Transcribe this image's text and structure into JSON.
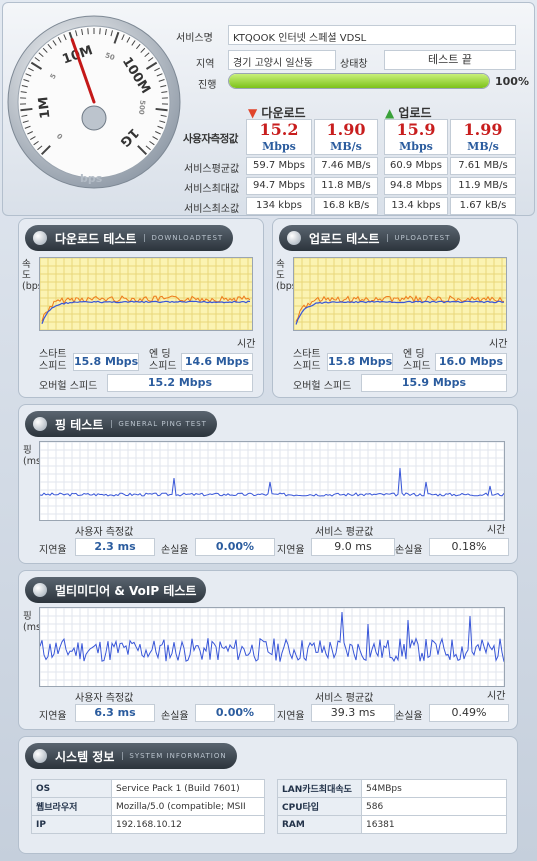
{
  "gauge": {
    "ticks": [
      "0",
      "1M",
      "5",
      "10M",
      "50",
      "100M",
      "500",
      "1G"
    ],
    "unit": "bps",
    "needle_value": "10M"
  },
  "top": {
    "service_name_label": "서비스명",
    "service_name": "KTQOOK 인터넷 스페셜 VDSL",
    "region_label": "지역",
    "region": "경기 고양시 일산동",
    "status_label": "상태창",
    "status": "테스트 끝",
    "progress_label": "진행",
    "progress_percent": 100,
    "progress_text": "100%"
  },
  "summary": {
    "download_header": "다운로드",
    "upload_header": "업로드",
    "measured_label": "사용자측정값",
    "dl_mbps": "15.2",
    "dl_mbs": "1.90",
    "ul_mbps": "15.9",
    "ul_mbs": "1.99",
    "unit_mbps": "Mbps",
    "unit_mbs": "MB/s",
    "rows": [
      {
        "label": "서비스평균값",
        "dl1": "59.7 Mbps",
        "dl2": "7.46 MB/s",
        "ul1": "60.9 Mbps",
        "ul2": "7.61 MB/s"
      },
      {
        "label": "서비스최대값",
        "dl1": "94.7 Mbps",
        "dl2": "11.8 MB/s",
        "ul1": "94.8 Mbps",
        "ul2": "11.9 MB/s"
      },
      {
        "label": "서비스최소값",
        "dl1": "134 kbps",
        "dl2": "16.8 kB/s",
        "ul1": "13.4 kbps",
        "ul2": "1.67 kB/s"
      }
    ]
  },
  "download_test": {
    "title": "다운로드 테스트",
    "subtitle": "DOWNLOADTEST",
    "ylabel": "속도(bps)",
    "xlabel": "시간",
    "start_label_1": "스타트",
    "start_label_2": "스피드",
    "start_value": "15.8 Mbps",
    "end_label_1": "엔 딩",
    "end_label_2": "스피드",
    "end_value": "14.6 Mbps",
    "overall_label": "오버헐 스피드",
    "overall_value": "15.2 Mbps"
  },
  "upload_test": {
    "title": "업로드 테스트",
    "subtitle": "UPLOADTEST",
    "ylabel": "속도(bps)",
    "xlabel": "시간",
    "start_label_1": "스타트",
    "start_label_2": "스피드",
    "start_value": "15.8 Mbps",
    "end_label_1": "엔 딩",
    "end_label_2": "스피드",
    "end_value": "16.0 Mbps",
    "overall_label": "오버헐 스피드",
    "overall_value": "15.9 Mbps"
  },
  "ping_test": {
    "title": "핑 테스트",
    "subtitle": "GENERAL PING TEST",
    "ylabel": "핑(ms)",
    "xlabel": "시간",
    "user_label": "사용자 측정값",
    "service_label": "서비스 평균값",
    "latency_label": "지연율",
    "loss_label": "손실율",
    "user_latency": "2.3 ms",
    "user_loss": "0.00%",
    "service_latency": "9.0 ms",
    "service_loss": "0.18%"
  },
  "multimedia_test": {
    "title": "멀티미디어 & VoIP 테스트",
    "ylabel": "핑(ms)",
    "xlabel": "시간",
    "user_label": "사용자 측정값",
    "service_label": "서비스 평균값",
    "latency_label": "지연율",
    "loss_label": "손실율",
    "user_latency": "6.3 ms",
    "user_loss": "0.00%",
    "service_latency": "39.3 ms",
    "service_loss": "0.49%"
  },
  "system_info": {
    "title": "시스템 정보",
    "subtitle": "SYSTEM INFORMATION",
    "os_label": "OS",
    "os_value": "Service Pack 1 (Build 7601)",
    "browser_label": "웹브라우저",
    "browser_value": "Mozilla/5.0 (compatible; MSII",
    "ip_label": "IP",
    "ip_value": "192.168.10.12",
    "lan_label": "LAN카드최대속도",
    "lan_value": "54MBps",
    "cpu_label": "CPU타입",
    "cpu_value": "586",
    "ram_label": "RAM",
    "ram_value": "16381"
  },
  "colors": {
    "download_arrow": "#e0442b",
    "upload_arrow": "#3aa13a",
    "value_red": "#c81e1e",
    "value_blue": "#2b5c9e",
    "progress": "#8fd12a",
    "line_blue": "#3856d8",
    "line_orange": "#ee7a1a"
  }
}
